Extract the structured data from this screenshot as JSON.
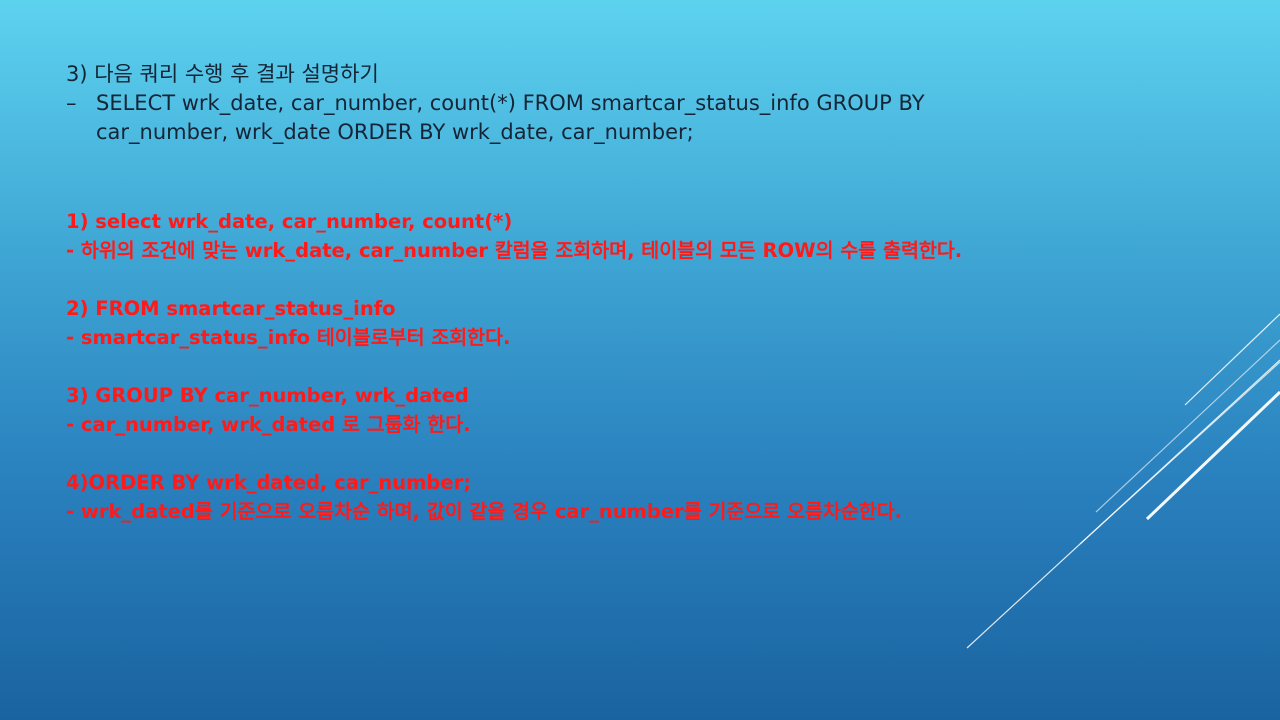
{
  "slide": {
    "question": {
      "title": "3) 다음 쿼리 수행 후 결과 설명하기",
      "dash": "–",
      "sql": "SELECT wrk_date, car_number, count(*) FROM smartcar_status_info GROUP BY car_number, wrk_date ORDER BY wrk_date, car_number;"
    },
    "answers": [
      {
        "heading": "1)  select wrk_date, car_number, count(*)",
        "explanation": "- 하위의 조건에 맞는 wrk_date, car_number 칼럼을 조회하며, 테이블의 모든 ROW의 수를 출력한다."
      },
      {
        "heading": "2) FROM smartcar_status_info",
        "explanation": "- smartcar_status_info 테이블로부터 조회한다."
      },
      {
        "heading": "3) GROUP BY car_number, wrk_dated",
        "explanation": "- car_number, wrk_dated 로 그룹화 한다."
      },
      {
        "heading": "4)ORDER BY wrk_dated, car_number;",
        "explanation": "-  wrk_dated를 기준으로 오름차순 하며, 값이 같을 경우 car_number를 기준으로 오름차순한다."
      }
    ]
  },
  "colors": {
    "question_text": "#152436",
    "answer_text": "#ff1a1a",
    "decor_lines": "#ffffff"
  }
}
